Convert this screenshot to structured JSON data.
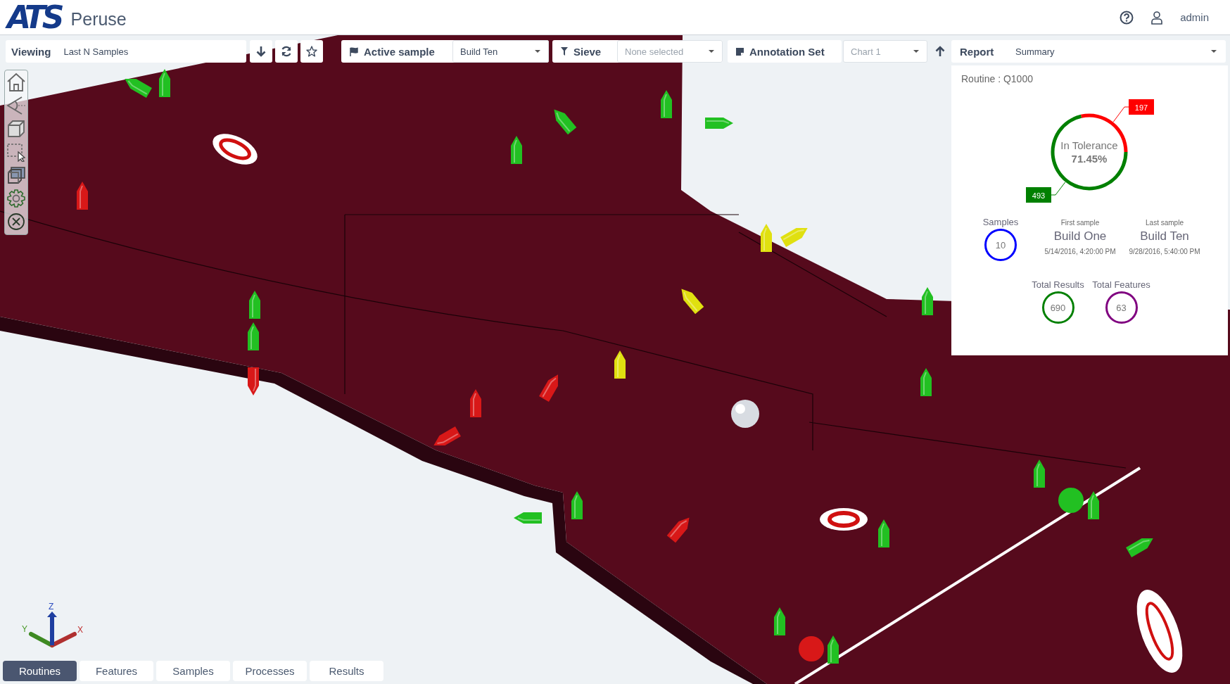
{
  "app": {
    "logo": "ATS",
    "title": "Peruse"
  },
  "user_menu": {
    "username": "admin"
  },
  "toolbar": {
    "viewing": {
      "label": "Viewing",
      "value": "Last N Samples"
    },
    "active_sample": {
      "label": "Active sample",
      "value": "Build Ten"
    },
    "sieve": {
      "label": "Sieve",
      "placeholder": "None selected"
    },
    "annotation_set": {
      "label": "Annotation Set",
      "value": "Chart 1"
    },
    "report": {
      "label": "Report",
      "value": "Summary"
    }
  },
  "report_panel": {
    "routine": "Routine : Q1000",
    "chart_data": {
      "type": "donut",
      "values": [
        197,
        493
      ],
      "colors": [
        "#ff0000",
        "#008000"
      ],
      "value_labels": [
        "197",
        "493"
      ]
    },
    "center_label": "In Tolerance",
    "center_value": "71.45%",
    "samples": {
      "label": "Samples",
      "value": "10",
      "color": "#0000ff"
    },
    "first_sample": {
      "caption": "First sample",
      "name": "Build One",
      "date": "5/14/2016, 4:20:00 PM"
    },
    "last_sample": {
      "caption": "Last sample",
      "name": "Build Ten",
      "date": "9/28/2016, 5:40:00 PM"
    },
    "totals": [
      {
        "label": "Total Results",
        "value": "690",
        "color": "#008000"
      },
      {
        "label": "Total Features",
        "value": "63",
        "color": "#800080"
      }
    ]
  },
  "axis_labels": {
    "x": "X",
    "y": "Y",
    "z": "Z"
  },
  "bottom_tabs": [
    {
      "label": "Routines",
      "selected": true
    },
    {
      "label": "Features",
      "selected": false
    },
    {
      "label": "Samples",
      "selected": false
    },
    {
      "label": "Processes",
      "selected": false
    },
    {
      "label": "Results",
      "selected": false
    }
  ]
}
